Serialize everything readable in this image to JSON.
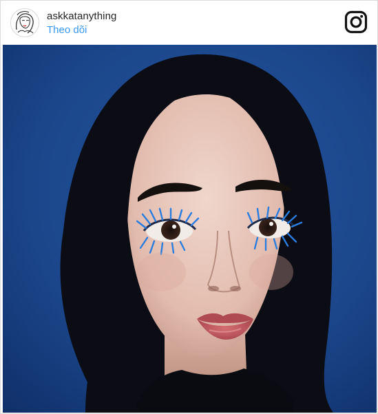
{
  "post": {
    "username": "askkatanything",
    "follow_label": "Theo dõi"
  },
  "icons": {
    "avatar": "avatar-sketch-portrait",
    "platform": "instagram-icon"
  },
  "photo": {
    "subject": "portrait-photo",
    "background_color": "#1a4585",
    "accent_color": "#2a7de0"
  },
  "colors": {
    "link": "#3897f0",
    "text": "#262626",
    "border": "#dbdbdb"
  }
}
